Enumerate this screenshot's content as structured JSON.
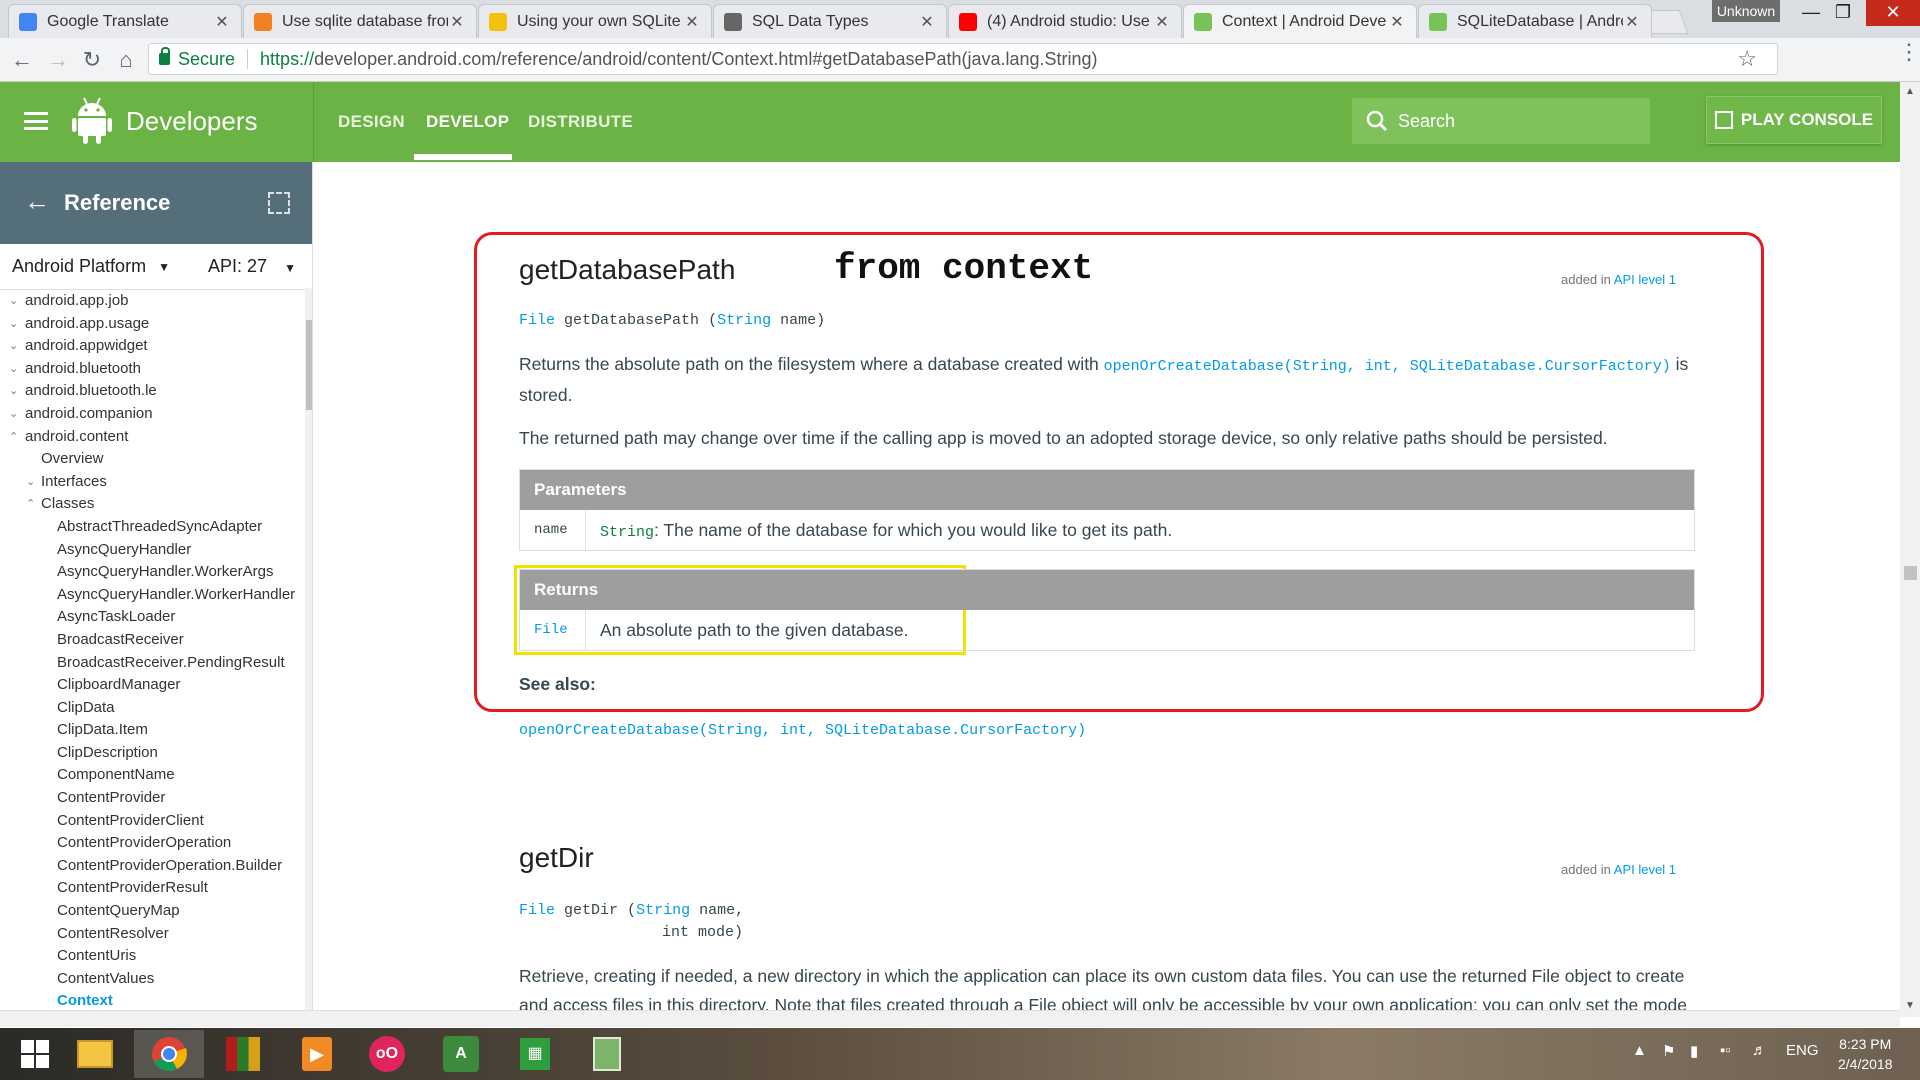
{
  "browser": {
    "tabs": [
      {
        "title": "Google Translate",
        "icon": "google-translate-icon",
        "color": "#4285f4"
      },
      {
        "title": "Use sqlite database from",
        "icon": "stackoverflow-icon",
        "color": "#f48024"
      },
      {
        "title": "Using your own SQLite",
        "icon": "folder-icon",
        "color": "#f4c20d"
      },
      {
        "title": "SQL Data Types",
        "icon": "sql-icon",
        "color": "#666666"
      },
      {
        "title": "(4) Android studio: Use",
        "icon": "youtube-icon",
        "color": "#ff0000"
      },
      {
        "title": "Context | Android Deve",
        "icon": "android-icon",
        "color": "#78c257"
      },
      {
        "title": "SQLiteDatabase | Andro",
        "icon": "android-icon",
        "color": "#78c257"
      }
    ],
    "window_user": "Unknown",
    "secure_label": "Secure",
    "url_scheme": "https://",
    "url_rest": "developer.android.com/reference/android/content/Context.html#getDatabasePath(java.lang.String)"
  },
  "header": {
    "brand": "Developers",
    "nav": [
      "DESIGN",
      "DEVELOP",
      "DISTRIBUTE"
    ],
    "active_nav": "DEVELOP",
    "search_placeholder": "Search",
    "play_console": "PLAY CONSOLE"
  },
  "sidebar": {
    "title": "Reference",
    "platform": "Android Platform",
    "api": "API: 27",
    "items": [
      {
        "label": "android.app.job",
        "level": 0
      },
      {
        "label": "android.app.usage",
        "level": 0
      },
      {
        "label": "android.appwidget",
        "level": 0
      },
      {
        "label": "android.bluetooth",
        "level": 0
      },
      {
        "label": "android.bluetooth.le",
        "level": 0
      },
      {
        "label": "android.companion",
        "level": 0
      },
      {
        "label": "android.content",
        "level": 0,
        "open": true
      },
      {
        "label": "Overview",
        "level": 1
      },
      {
        "label": "Interfaces",
        "level": 1
      },
      {
        "label": "Classes",
        "level": 1,
        "open": true
      },
      {
        "label": "AbstractThreadedSyncAdapter",
        "level": 2
      },
      {
        "label": "AsyncQueryHandler",
        "level": 2
      },
      {
        "label": "AsyncQueryHandler.WorkerArgs",
        "level": 2
      },
      {
        "label": "AsyncQueryHandler.WorkerHandler",
        "level": 2
      },
      {
        "label": "AsyncTaskLoader",
        "level": 2
      },
      {
        "label": "BroadcastReceiver",
        "level": 2
      },
      {
        "label": "BroadcastReceiver.PendingResult",
        "level": 2
      },
      {
        "label": "ClipboardManager",
        "level": 2
      },
      {
        "label": "ClipData",
        "level": 2
      },
      {
        "label": "ClipData.Item",
        "level": 2
      },
      {
        "label": "ClipDescription",
        "level": 2
      },
      {
        "label": "ComponentName",
        "level": 2
      },
      {
        "label": "ContentProvider",
        "level": 2
      },
      {
        "label": "ContentProviderClient",
        "level": 2
      },
      {
        "label": "ContentProviderOperation",
        "level": 2
      },
      {
        "label": "ContentProviderOperation.Builder",
        "level": 2
      },
      {
        "label": "ContentProviderResult",
        "level": 2
      },
      {
        "label": "ContentQueryMap",
        "level": 2
      },
      {
        "label": "ContentResolver",
        "level": 2
      },
      {
        "label": "ContentUris",
        "level": 2
      },
      {
        "label": "ContentValues",
        "level": 2
      },
      {
        "label": "Context",
        "level": 2,
        "active": true
      }
    ]
  },
  "method1": {
    "name": "getDatabasePath",
    "added_prefix": "added in",
    "added_link": "API level 1",
    "sig_type": "File",
    "sig_name": "getDatabasePath",
    "sig_param_type": "String",
    "sig_param_name": "name)",
    "desc1_before": "Returns the absolute path on the filesystem where a database created with",
    "desc1_link": "openOrCreateDatabase(String, int, SQLiteDatabase.CursorFactory)",
    "desc1_after": "is stored.",
    "desc2": "The returned path may change over time if the calling app is moved to an adopted storage device, so only relative paths should be persisted.",
    "params_header": "Parameters",
    "param_name": "name",
    "param_type": "String",
    "param_desc": ": The name of the database for which you would like to get its path.",
    "returns_header": "Returns",
    "returns_type": "File",
    "returns_desc": "An absolute path to the given database.",
    "see_also": "See also:",
    "see_also_link": "openOrCreateDatabase(String, int, SQLiteDatabase.CursorFactory)"
  },
  "annotation": "from context",
  "method2": {
    "name": "getDir",
    "added_prefix": "added in",
    "added_link": "API level 1",
    "sig_type": "File",
    "sig_name": "getDir",
    "sig_param1_type": "String",
    "sig_param1_name": "name,",
    "sig_param2": "int mode)",
    "desc_line1": "Retrieve, creating if needed, a new directory in which the application can place its own custom data files. You can use the returned File object to create",
    "desc_line2": "and access files in this directory. Note that files created through a File object will only be accessible by your own application; you can only set the mode"
  },
  "taskbar": {
    "language": "ENG",
    "time": "8:23 PM",
    "date": "2/4/2018"
  }
}
